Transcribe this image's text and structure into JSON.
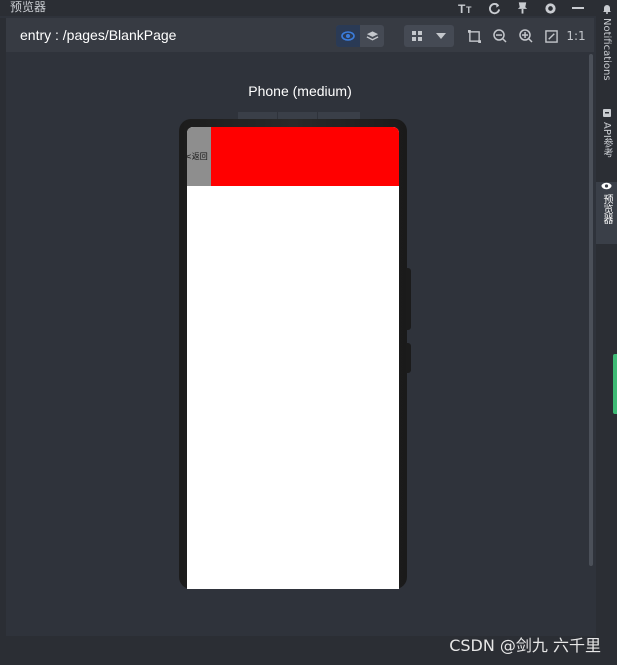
{
  "window": {
    "title": "预览器"
  },
  "toolbar": {
    "route": "entry : /pages/BlankPage",
    "zoom_reset_label": "1:1"
  },
  "device": {
    "label": "Phone (medium)"
  },
  "app": {
    "back_button_label": "<返回"
  },
  "rightbar": {
    "notifications": "Notifications",
    "api": "API参考",
    "previewer": "预览器"
  },
  "watermark": "CSDN @剑九 六千里",
  "colors": {
    "accent": "#3b7ddd",
    "app_header": "#ff0000",
    "back_button": "#8e8e8e",
    "green_tab": "#3dba74"
  }
}
